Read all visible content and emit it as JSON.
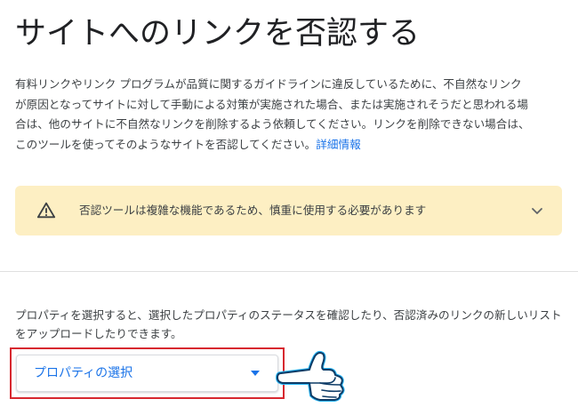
{
  "page": {
    "title": "サイトへのリンクを否認する",
    "intro_text": "有料リンクやリンク プログラムが品質に関するガイドラインに違反しているために、不自然なリンクが原因となってサイトに対して手動による対策が実施された場合、または実施されそうだと思われる場合は、他のサイトに不自然なリンクを削除するよう依頼してください。リンクを削除できない場合は、このツールを使ってそのようなサイトを否認してください。",
    "details_link": "詳細情報"
  },
  "warning": {
    "icon": "warning-triangle-icon",
    "text": "否認ツールは複雑な機能であるため、慎重に使用する必要があります",
    "expand_icon": "chevron-down-icon",
    "background_color": "#fdefc3"
  },
  "property": {
    "description": "プロパティを選択すると、選択したプロパティのステータスを確認したり、否認済みのリンクの新しいリストをアップロードしたりできます。",
    "select_label": "プロパティの選択",
    "accent_color": "#1a73e8"
  },
  "annotation": {
    "highlight_color": "#d7282f",
    "pointer_icon": "pointing-hand-icon"
  }
}
